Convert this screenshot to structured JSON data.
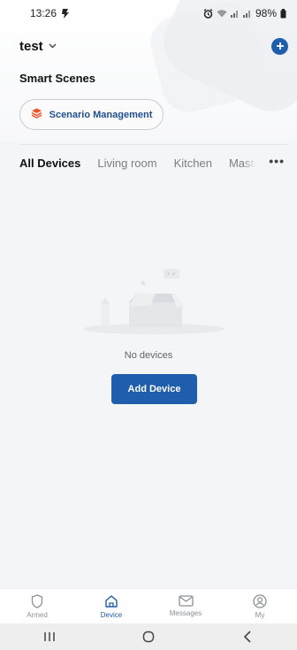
{
  "status_bar": {
    "time": "13:26",
    "battery": "98%",
    "icons": [
      "alarm-icon",
      "wifi-icon",
      "signal-icon",
      "signal-icon",
      "battery-icon"
    ]
  },
  "header": {
    "home_name": "test",
    "dropdown_icon": "chevron-down-icon",
    "add_icon": "plus-icon"
  },
  "smart_scenes": {
    "title": "Smart Scenes",
    "scenario_button_label": "Scenario Management",
    "scenario_icon": "layers-icon"
  },
  "tabs": [
    {
      "label": "All Devices",
      "active": true
    },
    {
      "label": "Living room",
      "active": false
    },
    {
      "label": "Kitchen",
      "active": false
    },
    {
      "label": "Maste",
      "active": false
    }
  ],
  "more_icon": "ellipsis-icon",
  "empty_state": {
    "message": "No devices",
    "add_button_label": "Add Device"
  },
  "bottom_nav": [
    {
      "label": "Armed",
      "icon": "shield-icon",
      "active": false
    },
    {
      "label": "Device",
      "icon": "home-icon",
      "active": true
    },
    {
      "label": "Messages",
      "icon": "mail-icon",
      "active": false
    },
    {
      "label": "My",
      "icon": "user-icon",
      "active": false
    }
  ],
  "colors": {
    "accent": "#1f5eac",
    "scenario_icon": "#e8562a",
    "background": "#f4f5f7"
  }
}
